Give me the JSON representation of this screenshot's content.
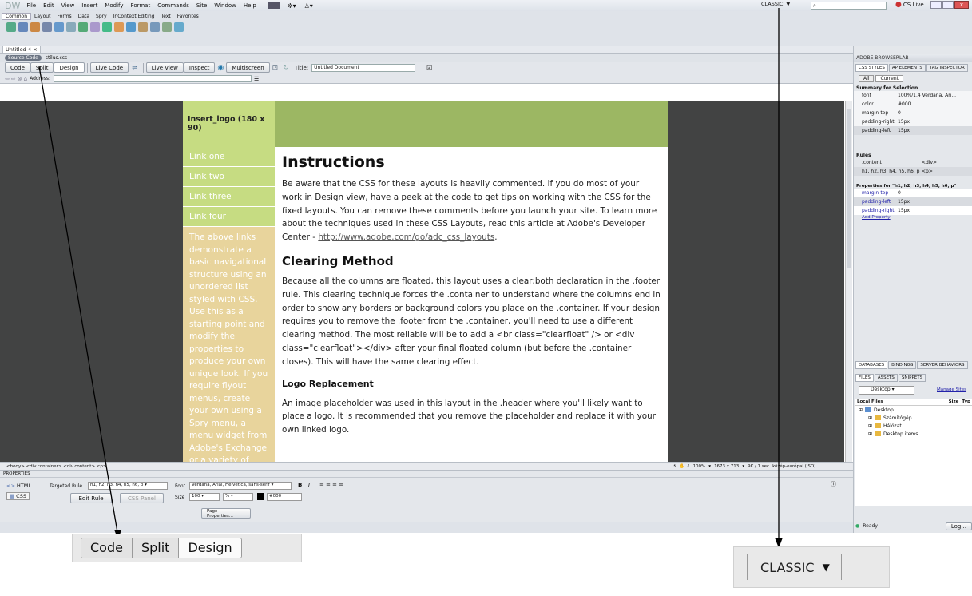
{
  "app": {
    "logo": "DW",
    "menus": [
      "File",
      "Edit",
      "View",
      "Insert",
      "Modify",
      "Format",
      "Commands",
      "Site",
      "Window",
      "Help"
    ],
    "workspace": "CLASSIC",
    "cslive": "CS Live"
  },
  "insert_tabs": [
    "Common",
    "Layout",
    "Forms",
    "Data",
    "Spry",
    "InContext Editing",
    "Text",
    "Favorites"
  ],
  "doc": {
    "tab": "Untitled-4",
    "source_code": "Source Code",
    "file": "stílus.css"
  },
  "doc_toolbar": {
    "code": "Code",
    "split": "Split",
    "design": "Design",
    "live_code": "Live Code",
    "live_view": "Live View",
    "inspect": "Inspect",
    "multiscreen": "Multiscreen",
    "title_label": "Title:",
    "title_value": "Untitled Document",
    "address_label": "Address:"
  },
  "page": {
    "logo": "Insert_logo (180 x 90)",
    "links": [
      "Link one",
      "Link two",
      "Link three",
      "Link four"
    ],
    "sidebar": "The above links demonstrate a basic navigational structure using an unordered list styled with CSS. Use this as a starting point and modify the properties to produce your own unique look. If you require flyout menus, create your own using a Spry menu, a menu widget from Adobe's Exchange or a variety of",
    "h1": "Instructions",
    "p1": "Be aware that the CSS for these layouts is heavily commented. If you do most of your work in Design view, have a peek at the code to get tips on working with the CSS for the fixed layouts. You can remove these comments before you launch your site. To learn more about the techniques used in these CSS Layouts, read this article at Adobe's Developer Center - ",
    "p1_link": "http://www.adobe.com/go/adc_css_layouts",
    "h2": "Clearing Method",
    "p2": "Because all the columns are floated, this layout uses a clear:both declaration in the .footer rule. This clearing technique forces the .container to understand where the columns end in order to show any borders or background colors you place on the .container. If your design requires you to remove the .footer from the .container, you'll need to use a different clearing method. The most reliable will be to add a <br class=\"clearfloat\" /> or <div class=\"clearfloat\"></div> after your final floated column (but before the .container closes). This will have the same clearing effect.",
    "h3": "Logo Replacement",
    "p3": "An image placeholder was used in this layout in the .header where you'll likely want to place a logo. It is recommended that you remove the placeholder and replace it with your own linked logo."
  },
  "status": {
    "tags": "<body> <div.container> <div.content> <p>",
    "zoom": "100%",
    "size": "1673 x 713",
    "weight": "9K / 1 sec",
    "encoding": "közép-európai (ISO)"
  },
  "props": {
    "title": "PROPERTIES",
    "html": "HTML",
    "css": "CSS",
    "targeted_rule_label": "Targeted Rule",
    "targeted_rule": "h1, h2, h3, h4, h5, h6, p",
    "edit_rule": "Edit Rule",
    "css_panel": "CSS Panel",
    "font_label": "Font",
    "font": "Verdana, Arial, Helvetica, sans-serif",
    "size_label": "Size",
    "size": "100",
    "unit": "%",
    "color": "#000",
    "page_props": "Page Properties..."
  },
  "right": {
    "browserlab": "ADOBE BROWSERLAB",
    "css_tabs": [
      "CSS STYLES",
      "AP ELEMENTS",
      "TAG INSPECTOR"
    ],
    "modes": [
      "All",
      "Current"
    ],
    "summary_title": "Summary for Selection",
    "summary": [
      [
        "font",
        "100%/1.4 Verdana, Ari..."
      ],
      [
        "color",
        "#000"
      ],
      [
        "margin-top",
        "0"
      ],
      [
        "padding-right",
        "15px"
      ],
      [
        "padding-left",
        "15px"
      ]
    ],
    "rules_title": "Rules",
    "rules": [
      [
        ".content",
        "<div>"
      ],
      [
        "h1, h2, h3, h4, h5, h6, p",
        "<p>"
      ]
    ],
    "props_title": "Properties for \"h1, h2, h3, h4, h5, h6, p\"",
    "props": [
      [
        "margin-top",
        "0"
      ],
      [
        "padding-left",
        "15px"
      ],
      [
        "padding-right",
        "15px"
      ]
    ],
    "add_property": "Add Property",
    "db_tabs": [
      "DATABASES",
      "BINDINGS",
      "SERVER BEHAVIORS"
    ],
    "files_tabs": [
      "FILES",
      "ASSETS",
      "SNIPPETS"
    ],
    "site": "Desktop",
    "manage": "Manage Sites",
    "local_files": "Local Files",
    "size_col": "Size",
    "type_col": "Typ",
    "tree": [
      "Desktop",
      "Számítógép",
      "Hálózat",
      "Desktop items"
    ],
    "ready": "Ready",
    "log": "Log..."
  },
  "callout": {
    "code": "Code",
    "split": "Split",
    "design": "Design",
    "classic": "CLASSIC"
  }
}
